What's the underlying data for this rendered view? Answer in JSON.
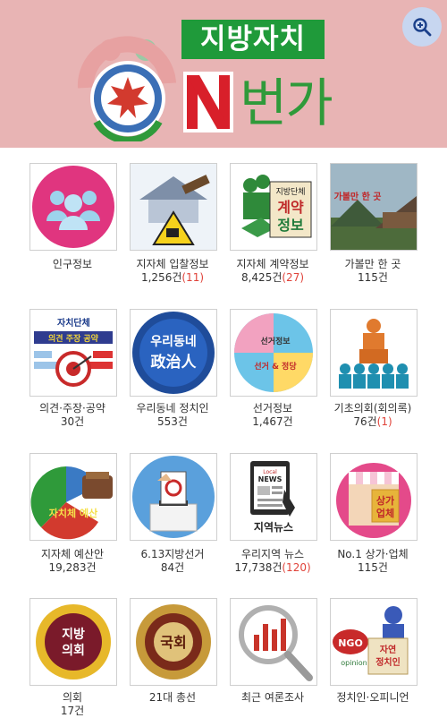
{
  "header": {
    "title": "지방자치",
    "subtitle_letter": "N",
    "subtitle": "번가",
    "zoom_icon": "zoom-in-icon",
    "bg_color": "#e8b4b4",
    "accent_green": "#1f9a3a"
  },
  "items": [
    {
      "label": "인구정보",
      "count": "",
      "extra": "",
      "icon": "people-icon"
    },
    {
      "label": "지자체 입찰정보",
      "count": "1,256건",
      "extra": "(11)",
      "icon": "bidding-icon"
    },
    {
      "label": "지자체 계약정보",
      "count": "8,425건",
      "extra": "(27)",
      "icon": "contract-icon",
      "img_text1": "지방단체",
      "img_text2": "계약",
      "img_text3": "정보"
    },
    {
      "label": "가볼만 한 곳",
      "count": "115건",
      "extra": "",
      "icon": "attraction-photo",
      "img_text1": "가볼만 한 곳"
    },
    {
      "label": "의견·주장·공약",
      "count": "30건",
      "extra": "",
      "icon": "opinion-target-icon",
      "img_text1": "자치단체",
      "img_text2": "의견 주장 공약"
    },
    {
      "label": "우리동네 정치인",
      "count": "553건",
      "extra": "",
      "icon": "politician-icon",
      "img_text1": "우리동네",
      "img_text2": "政治人"
    },
    {
      "label": "선거정보",
      "count": "1,467건",
      "extra": "",
      "icon": "election-info-icon",
      "img_text1": "선거정보",
      "img_text2": "선거 & 정당"
    },
    {
      "label": "기초의회(회의록)",
      "count": "76건",
      "extra": "(1)",
      "icon": "assembly-podium-icon"
    },
    {
      "label": "지자체 예산안",
      "count": "19,283건",
      "extra": "",
      "icon": "budget-pie-icon",
      "img_text1": "자치체 예산"
    },
    {
      "label": "6.13지방선거",
      "count": "84건",
      "extra": "",
      "icon": "ballot-box-icon"
    },
    {
      "label": "우리지역 뉴스",
      "count": "17,738건",
      "extra": "(120)",
      "icon": "local-news-icon",
      "img_text1": "Local",
      "img_text2": "NEWS",
      "img_text3": "지역뉴스"
    },
    {
      "label": "No.1 상가·업체",
      "count": "115건",
      "extra": "",
      "icon": "storefront-icon",
      "img_text1": "상가",
      "img_text2": "업체"
    },
    {
      "label": "의회",
      "count": "17건",
      "extra": "",
      "icon": "council-badge-icon",
      "img_text1": "지방",
      "img_text2": "의회"
    },
    {
      "label": "21대 총선",
      "count": "",
      "extra": "",
      "icon": "national-assembly-seal-icon",
      "img_text1": "국회"
    },
    {
      "label": "최근 여론조사",
      "count": "",
      "extra": "",
      "icon": "poll-magnifier-icon"
    },
    {
      "label": "정치인·오피니언",
      "count": "",
      "extra": "",
      "icon": "ngo-opinion-icon",
      "img_text1": "NGO",
      "img_text2": "자연",
      "img_text3": "정치인",
      "img_text4": "opinion"
    }
  ]
}
